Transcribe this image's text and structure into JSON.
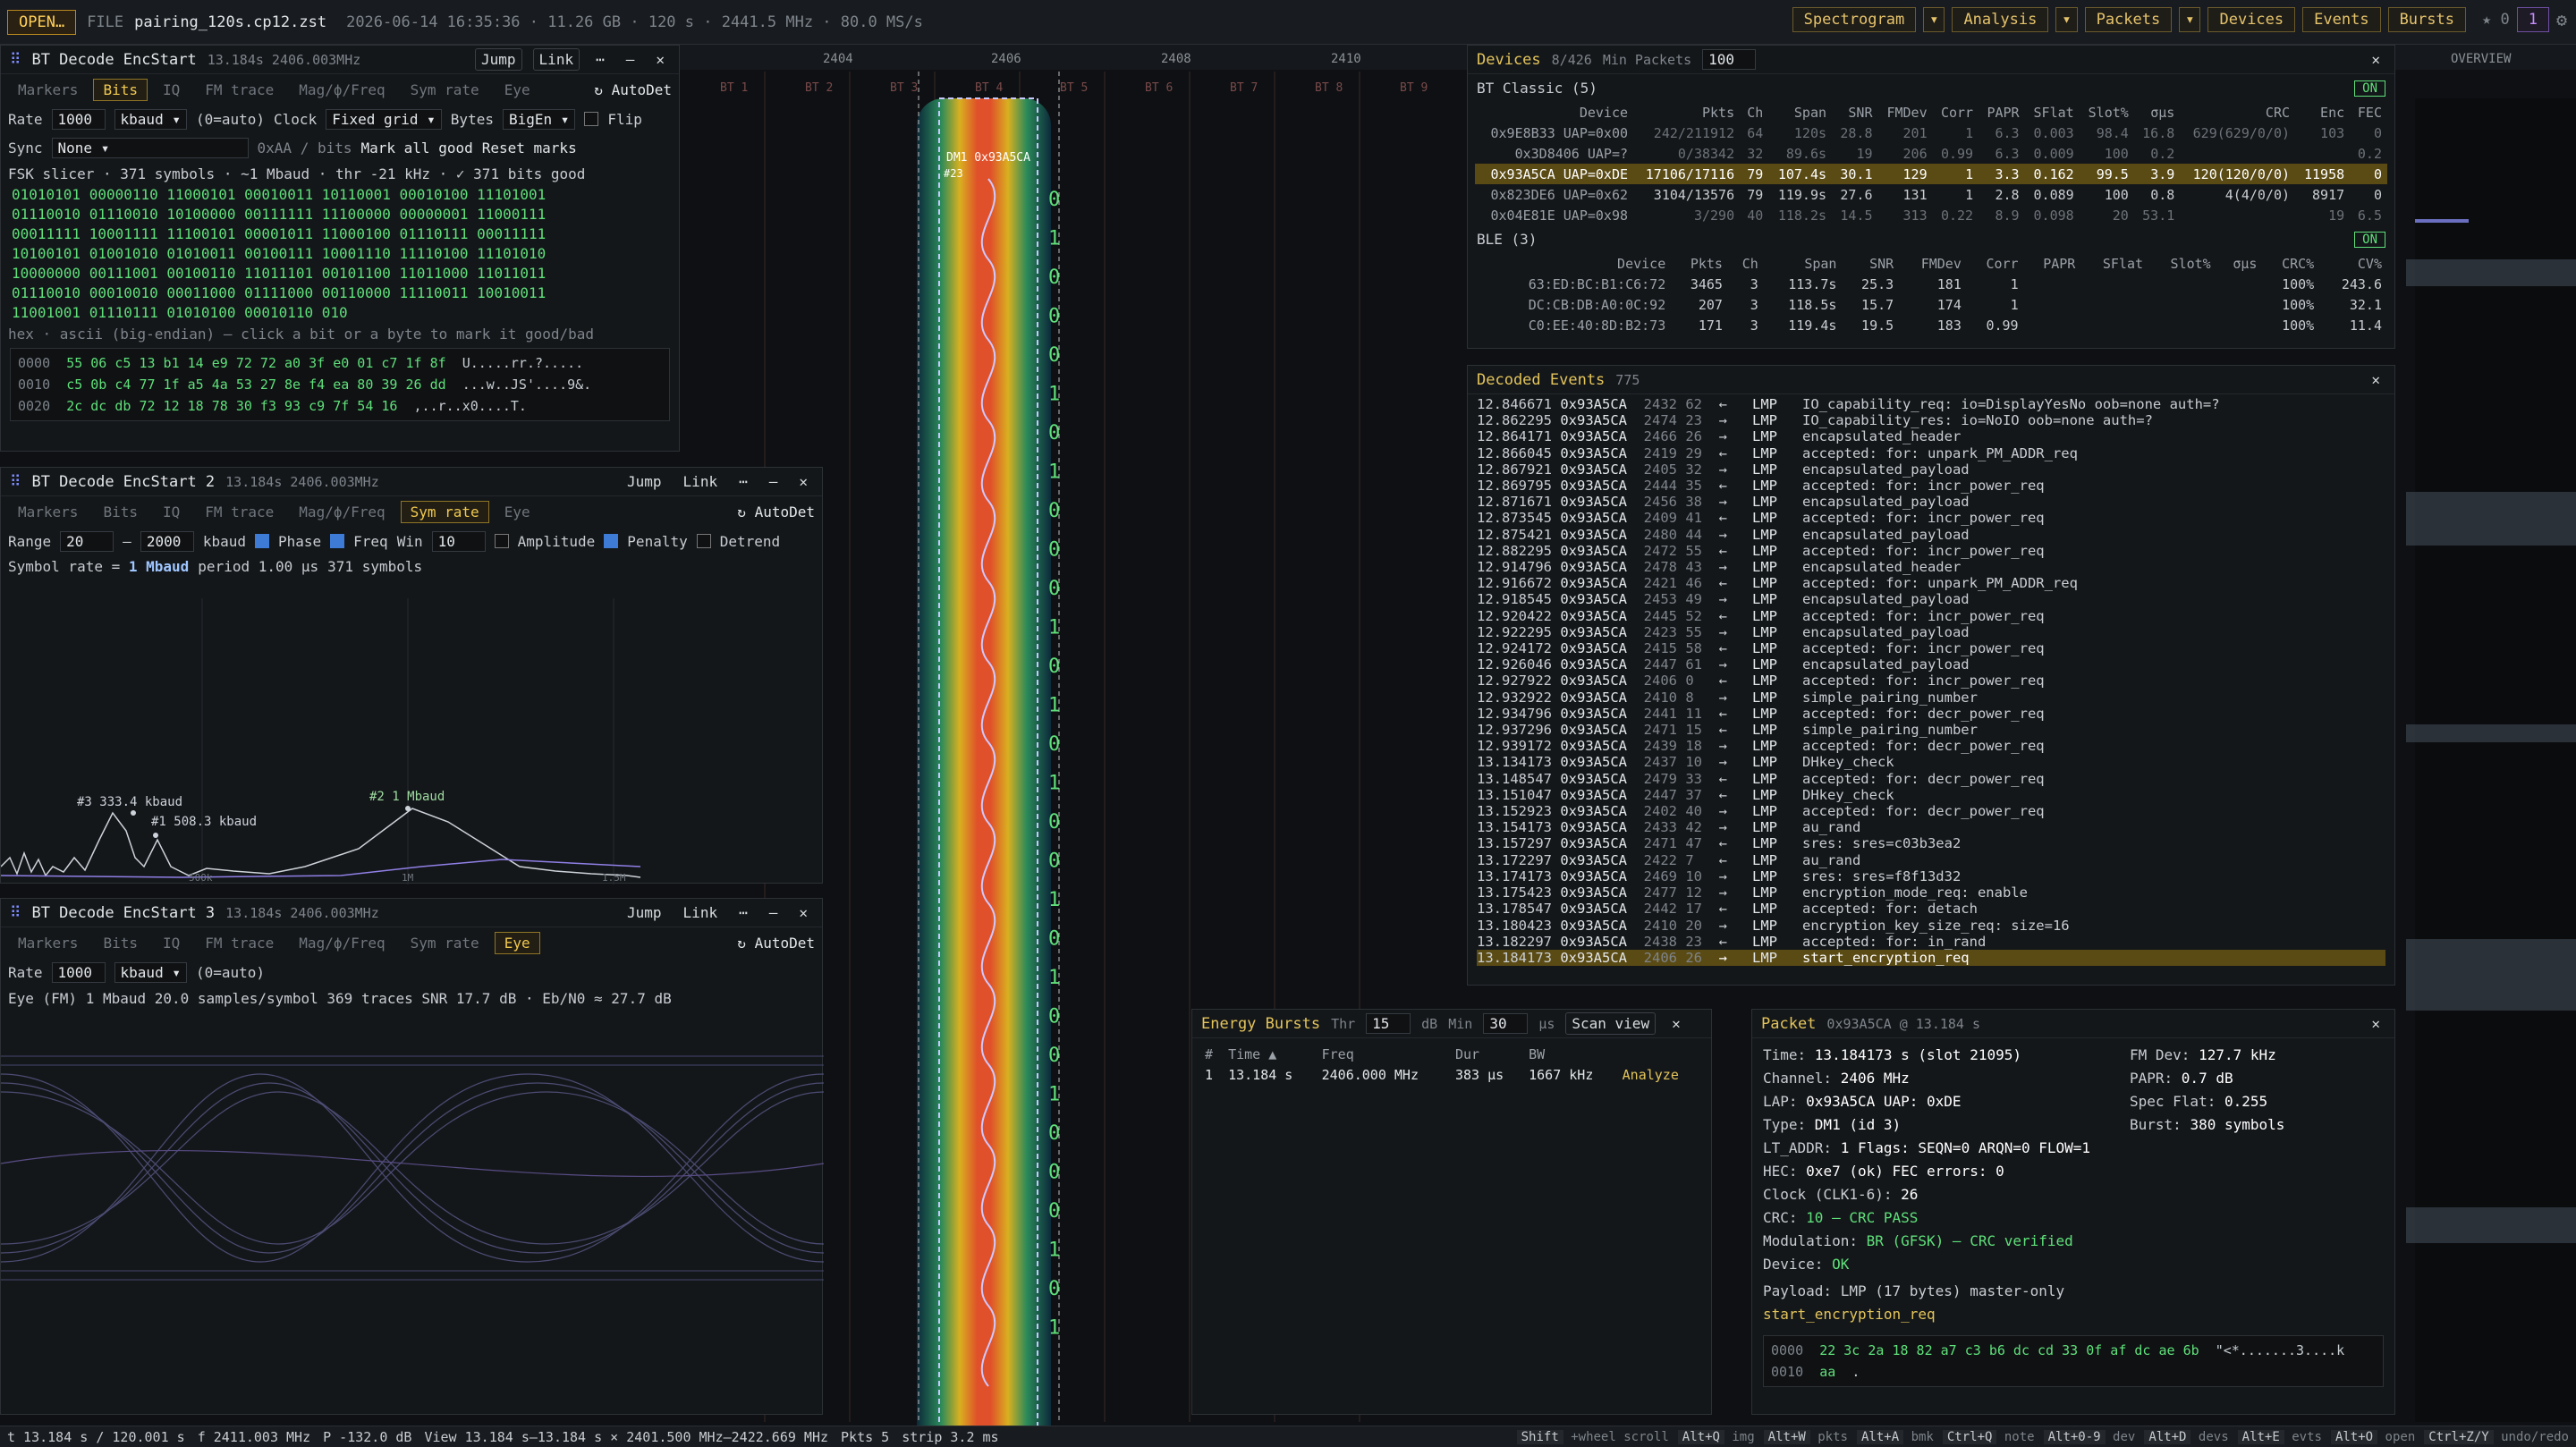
{
  "topbar": {
    "open": "OPEN…",
    "file_label": "FILE",
    "file": "pairing_120s.cp12.zst",
    "meta": "2026-06-14 16:35:36 · 11.26 GB · 120 s · 2441.5 MHz · 80.0 MS/s",
    "menus": [
      "Spectrogram",
      "Analysis",
      "Packets",
      "Devices",
      "Events",
      "Bursts"
    ],
    "star": "★ 0",
    "count": "1"
  },
  "ruler": {
    "ticks": [
      "2404",
      "2406",
      "2408",
      "2410"
    ],
    "channels": [
      "BT 1",
      "BT 2",
      "BT 3",
      "BT 4",
      "BT 5",
      "BT 6",
      "BT 7",
      "BT 8",
      "BT 9"
    ],
    "overview": "OVERVIEW"
  },
  "spectro": {
    "label": "DM1 0x93A5CA",
    "label2": "#23",
    "bits": [
      "0",
      "1",
      "0",
      "0",
      "0",
      "1",
      "0",
      "1",
      "0",
      "0",
      "0",
      "1",
      "0",
      "1",
      "0",
      "1",
      "0",
      "0",
      "1",
      "0",
      "1",
      "0",
      "0",
      "1",
      "0",
      "0",
      "0",
      "1",
      "0",
      "1"
    ]
  },
  "p1": {
    "title": "BT Decode EncStart",
    "sub": "13.184s 2406.003MHz",
    "jump": "Jump",
    "link": "Link",
    "tabs": [
      "Markers",
      "Bits",
      "IQ",
      "FM trace",
      "Mag/ϕ/Freq",
      "Sym rate",
      "Eye"
    ],
    "autodet": "AutoDet",
    "rate_label": "Rate",
    "rate": "1000",
    "unit": "kbaud",
    "auto": "(0=auto)",
    "clock_label": "Clock",
    "clock": "Fixed grid",
    "bytes_label": "Bytes",
    "bytes": "BigEn",
    "flip": "Flip",
    "sync_label": "Sync",
    "sync": "None",
    "sync_hint": "0xAA / bits",
    "mark_good": "Mark all good",
    "reset": "Reset marks",
    "summary": "FSK slicer · 371 symbols · ~1 Mbaud · thr -21 kHz · ✓ 371 bits good",
    "bits": [
      "01010101 00000110 11000101 00010011 10110001 00010100 11101001",
      "01110010 01110010 10100000 00111111 11100000 00000001 11000111",
      "00011111 10001111 11100101 00001011 11000100 01110111 00011111",
      "10100101 01001010 01010011 00100111 10001110 11110100 11101010",
      "10000000 00111001 00100110 11011101 00101100 11011000 11011011",
      "01110010 00010010 00011000 01111000 00110000 11110011 10010011",
      "11001001 01110111 01010100 00010110 010"
    ],
    "hex_hint": "hex · ascii (big-endian) — click a bit or a byte to mark it good/bad",
    "hex": [
      {
        "a": "0000",
        "h": "55 06 c5 13 b1 14 e9 72 72 a0 3f e0 01 c7 1f 8f",
        "s": "U.....rr.?....."
      },
      {
        "a": "0010",
        "h": "c5 0b c4 77 1f a5 4a 53 27 8e f4 ea 80 39 26 dd",
        "s": "...w..JS'....9&."
      },
      {
        "a": "0020",
        "h": "2c dc db 72 12 18 78 30 f3 93 c9 7f 54 16",
        "s": ",..r..x0....T."
      }
    ]
  },
  "p2": {
    "title": "BT Decode EncStart 2",
    "sub": "13.184s 2406.003MHz",
    "jump": "Jump",
    "link": "Link",
    "tabs": [
      "Markers",
      "Bits",
      "IQ",
      "FM trace",
      "Mag/ϕ/Freq",
      "Sym rate",
      "Eye"
    ],
    "autodet": "AutoDet",
    "range_label": "Range",
    "range_lo": "20",
    "range_hi": "2000",
    "unit": "kbaud",
    "phase": "Phase",
    "freq": "Freq",
    "win_label": "Win",
    "win": "10",
    "amplitude": "Amplitude",
    "penalty": "Penalty",
    "detrend": "Detrend",
    "symrate": "Symbol rate = ",
    "symrate_val": "1 Mbaud",
    "period": "period 1.00 µs",
    "symbols": "371 symbols",
    "peaks": [
      "#3 333.4 kbaud",
      "#1 508.3 kbaud",
      "#2 1 Mbaud"
    ],
    "axis": [
      "500k",
      "1M",
      "1.5M"
    ]
  },
  "p3": {
    "title": "BT Decode EncStart 3",
    "sub": "13.184s 2406.003MHz",
    "jump": "Jump",
    "link": "Link",
    "tabs": [
      "Markers",
      "Bits",
      "IQ",
      "FM trace",
      "Mag/ϕ/Freq",
      "Sym rate",
      "Eye"
    ],
    "autodet": "AutoDet",
    "rate_label": "Rate",
    "rate": "1000",
    "unit": "kbaud",
    "auto": "(0=auto)",
    "eye_info": "Eye (FM)  1 Mbaud  20.0 samples/symbol  369 traces  SNR 17.7 dB · Eb/N0 ≈ 27.7 dB"
  },
  "devices": {
    "title": "Devices",
    "count": "8/426",
    "min_label": "Min Packets",
    "min": "100",
    "classic_title": "BT Classic (5)",
    "on": "ON",
    "classic_headers": [
      "Device",
      "Pkts",
      "Ch",
      "Span",
      "SNR",
      "FMDev",
      "Corr",
      "PAPR",
      "SFlat",
      "Slot%",
      "σµs",
      "CRC",
      "Enc",
      "FEC"
    ],
    "classic_rows": [
      [
        "0x9E8B33 UAP=0x00",
        "242/211912",
        "64",
        "120s",
        "28.8",
        "201",
        "1",
        "6.3",
        "0.003",
        "98.4",
        "16.8",
        "629(629/0/0)",
        "103",
        "0"
      ],
      [
        "0x3D8406 UAP=?",
        "0/38342",
        "32",
        "89.6s",
        "19",
        "206",
        "0.99",
        "6.3",
        "0.009",
        "100",
        "0.2",
        "",
        "",
        "0.2"
      ],
      [
        "0x93A5CA UAP=0xDE",
        "17106/17116",
        "79",
        "107.4s",
        "30.1",
        "129",
        "1",
        "3.3",
        "0.162",
        "99.5",
        "3.9",
        "120(120/0/0)",
        "11958",
        "0"
      ],
      [
        "0x823DE6 UAP=0x62",
        "3104/13576",
        "79",
        "119.9s",
        "27.6",
        "131",
        "1",
        "2.8",
        "0.089",
        "100",
        "0.8",
        "4(4/0/0)",
        "8917",
        "0"
      ],
      [
        "0x04E81E UAP=0x98",
        "3/290",
        "40",
        "118.2s",
        "14.5",
        "313",
        "0.22",
        "8.9",
        "0.098",
        "20",
        "53.1",
        "",
        "19",
        "6.5"
      ]
    ],
    "ble_title": "BLE (3)",
    "ble_headers": [
      "Device",
      "Pkts",
      "Ch",
      "Span",
      "SNR",
      "FMDev",
      "Corr",
      "PAPR",
      "SFlat",
      "Slot%",
      "σµs",
      "CRC%",
      "CV%"
    ],
    "ble_rows": [
      [
        "63:ED:BC:B1:C6:72",
        "3465",
        "3",
        "113.7s",
        "25.3",
        "181",
        "1",
        "",
        "",
        "",
        "",
        "100%",
        "243.6"
      ],
      [
        "DC:CB:DB:A0:0C:92",
        "207",
        "3",
        "118.5s",
        "15.7",
        "174",
        "1",
        "",
        "",
        "",
        "",
        "100%",
        "32.1"
      ],
      [
        "C0:EE:40:8D:B2:73",
        "171",
        "3",
        "119.4s",
        "19.5",
        "183",
        "0.99",
        "",
        "",
        "",
        "",
        "100%",
        "11.4"
      ]
    ]
  },
  "events": {
    "title": "Decoded Events",
    "count": "775",
    "rows": [
      [
        "12.846671",
        "0x93A5CA",
        "2432 62",
        "←",
        "LMP",
        "IO_capability_req: io=DisplayYesNo oob=none auth=?"
      ],
      [
        "12.862295",
        "0x93A5CA",
        "2474 23",
        "→",
        "LMP",
        "IO_capability_res: io=NoIO oob=none auth=?"
      ],
      [
        "12.864171",
        "0x93A5CA",
        "2466 26",
        "→",
        "LMP",
        "encapsulated_header"
      ],
      [
        "12.866045",
        "0x93A5CA",
        "2419 29",
        "←",
        "LMP",
        "accepted: for: unpark_PM_ADDR_req"
      ],
      [
        "12.867921",
        "0x93A5CA",
        "2405 32",
        "→",
        "LMP",
        "encapsulated_payload"
      ],
      [
        "12.869795",
        "0x93A5CA",
        "2444 35",
        "←",
        "LMP",
        "accepted: for: incr_power_req"
      ],
      [
        "12.871671",
        "0x93A5CA",
        "2456 38",
        "→",
        "LMP",
        "encapsulated_payload"
      ],
      [
        "12.873545",
        "0x93A5CA",
        "2409 41",
        "←",
        "LMP",
        "accepted: for: incr_power_req"
      ],
      [
        "12.875421",
        "0x93A5CA",
        "2480 44",
        "→",
        "LMP",
        "encapsulated_payload"
      ],
      [
        "12.882295",
        "0x93A5CA",
        "2472 55",
        "←",
        "LMP",
        "accepted: for: incr_power_req"
      ],
      [
        "12.914796",
        "0x93A5CA",
        "2478 43",
        "→",
        "LMP",
        "encapsulated_header"
      ],
      [
        "12.916672",
        "0x93A5CA",
        "2421 46",
        "←",
        "LMP",
        "accepted: for: unpark_PM_ADDR_req"
      ],
      [
        "12.918545",
        "0x93A5CA",
        "2453 49",
        "→",
        "LMP",
        "encapsulated_payload"
      ],
      [
        "12.920422",
        "0x93A5CA",
        "2445 52",
        "←",
        "LMP",
        "accepted: for: incr_power_req"
      ],
      [
        "12.922295",
        "0x93A5CA",
        "2423 55",
        "→",
        "LMP",
        "encapsulated_payload"
      ],
      [
        "12.924172",
        "0x93A5CA",
        "2415 58",
        "←",
        "LMP",
        "accepted: for: incr_power_req"
      ],
      [
        "12.926046",
        "0x93A5CA",
        "2447 61",
        "→",
        "LMP",
        "encapsulated_payload"
      ],
      [
        "12.927922",
        "0x93A5CA",
        "2406 0",
        "←",
        "LMP",
        "accepted: for: incr_power_req"
      ],
      [
        "12.932922",
        "0x93A5CA",
        "2410 8",
        "→",
        "LMP",
        "simple_pairing_number"
      ],
      [
        "12.934796",
        "0x93A5CA",
        "2441 11",
        "←",
        "LMP",
        "accepted: for: decr_power_req"
      ],
      [
        "12.937296",
        "0x93A5CA",
        "2471 15",
        "←",
        "LMP",
        "simple_pairing_number"
      ],
      [
        "12.939172",
        "0x93A5CA",
        "2439 18",
        "→",
        "LMP",
        "accepted: for: decr_power_req"
      ],
      [
        "13.134173",
        "0x93A5CA",
        "2437 10",
        "→",
        "LMP",
        "DHkey_check"
      ],
      [
        "13.148547",
        "0x93A5CA",
        "2479 33",
        "←",
        "LMP",
        "accepted: for: decr_power_req"
      ],
      [
        "13.151047",
        "0x93A5CA",
        "2447 37",
        "←",
        "LMP",
        "DHkey_check"
      ],
      [
        "13.152923",
        "0x93A5CA",
        "2402 40",
        "→",
        "LMP",
        "accepted: for: decr_power_req"
      ],
      [
        "13.154173",
        "0x93A5CA",
        "2433 42",
        "→",
        "LMP",
        "au_rand"
      ],
      [
        "13.157297",
        "0x93A5CA",
        "2471 47",
        "←",
        "LMP",
        "sres: sres=c03b3ea2"
      ],
      [
        "13.172297",
        "0x93A5CA",
        "2422 7",
        "←",
        "LMP",
        "au_rand"
      ],
      [
        "13.174173",
        "0x93A5CA",
        "2469 10",
        "→",
        "LMP",
        "sres: sres=f8f13d32"
      ],
      [
        "13.175423",
        "0x93A5CA",
        "2477 12",
        "→",
        "LMP",
        "encryption_mode_req: enable"
      ],
      [
        "13.178547",
        "0x93A5CA",
        "2442 17",
        "←",
        "LMP",
        "accepted: for: detach"
      ],
      [
        "13.180423",
        "0x93A5CA",
        "2410 20",
        "→",
        "LMP",
        "encryption_key_size_req: size=16"
      ],
      [
        "13.182297",
        "0x93A5CA",
        "2438 23",
        "←",
        "LMP",
        "accepted: for: in_rand"
      ],
      [
        "13.184173",
        "0x93A5CA",
        "2406 26",
        "→",
        "LMP",
        "start_encryption_req"
      ]
    ]
  },
  "bursts": {
    "title": "Energy Bursts",
    "thr_label": "Thr",
    "thr": "15",
    "db": "dB",
    "min_label": "Min",
    "min": "30",
    "us": "µs",
    "scan": "Scan view",
    "headers": [
      "#",
      "Time ▲",
      "Freq",
      "Dur",
      "BW"
    ],
    "row": [
      "1",
      "13.184 s",
      "2406.000 MHz",
      "383 µs",
      "1667 kHz"
    ],
    "analyze": "Analyze"
  },
  "packet": {
    "title": "Packet",
    "sub": "0x93A5CA @ 13.184 s",
    "left": [
      [
        "Time:",
        "13.184173 s (slot 21095)"
      ],
      [
        "Channel:",
        "2406 MHz"
      ],
      [
        "LAP:",
        "0x93A5CA  UAP: 0xDE"
      ],
      [
        "Type:",
        "DM1 (id 3)"
      ],
      [
        "LT_ADDR:",
        "1  Flags: SEQN=0 ARQN=0 FLOW=1"
      ],
      [
        "HEC:",
        "0xe7 (ok)  FEC errors: 0"
      ],
      [
        "Clock (CLK1-6):",
        "26"
      ],
      [
        "CRC:",
        "10 — CRC PASS"
      ],
      [
        "Modulation:",
        "BR (GFSK) — CRC verified"
      ],
      [
        "Device:",
        "OK"
      ]
    ],
    "right": [
      [
        "FM Dev:",
        "127.7 kHz"
      ],
      [
        "PAPR:",
        "0.7 dB"
      ],
      [
        "Spec Flat:",
        "0.255"
      ],
      [
        "Burst:",
        "380 symbols"
      ]
    ],
    "payload": "Payload: LMP (17 bytes) master-only",
    "payload_name": "start_encryption_req",
    "hex": [
      {
        "a": "0000",
        "h": "22 3c 2a 18 82 a7 c3 b6 dc cd 33 0f af dc ae 6b",
        "s": "\"<*.......3....k"
      },
      {
        "a": "0010",
        "h": "aa",
        "s": "."
      }
    ]
  },
  "status": {
    "time": "t 13.184 s / 120.001 s",
    "freq": "f 2411.003 MHz",
    "power": "P -132.0 dB",
    "view": "View 13.184 s–13.184 s × 2401.500 MHz–2422.669 MHz",
    "pkts": "Pkts 5",
    "strip": "strip 3.2 ms",
    "keys": [
      "Shift +wheel scroll",
      "Alt+Q img",
      "Alt+W pkts",
      "Alt+A bmk",
      "Ctrl+Q note",
      "Alt+0-9 dev",
      "Alt+D devs",
      "Alt+E evts",
      "Alt+O open",
      "Ctrl+Z/Y undo/redo"
    ]
  }
}
